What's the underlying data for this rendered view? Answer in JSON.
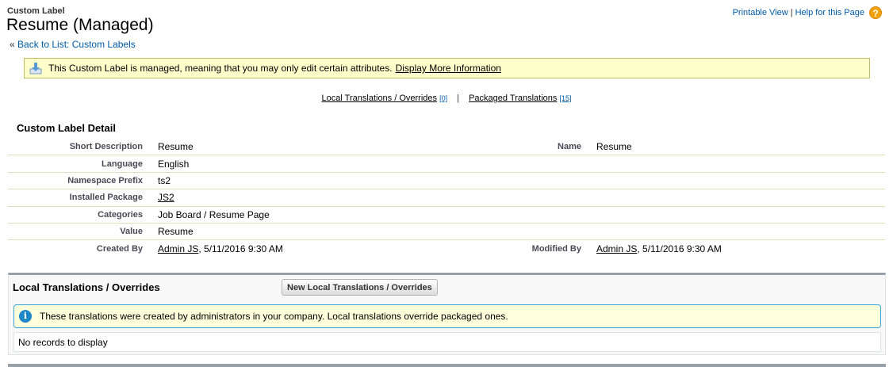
{
  "header": {
    "type_label": "Custom Label",
    "title": "Resume (Managed)",
    "back_prefix": "«",
    "back_link": "Back to List: Custom Labels",
    "printable_view": "Printable View",
    "separator": "|",
    "help_link": "Help for this Page",
    "help_icon": "question-mark-icon",
    "help_glyph": "?"
  },
  "notice": {
    "icon": "download-icon",
    "text": "This Custom Label is managed, meaning that you may only edit certain attributes.",
    "link": "Display More Information"
  },
  "related_links": {
    "local_label": "Local Translations / Overrides",
    "local_count": "[0]",
    "separator": "|",
    "packaged_label": "Packaged Translations",
    "packaged_count": "[15]"
  },
  "detail": {
    "title": "Custom Label Detail",
    "rows": [
      {
        "label": "Short Description",
        "value": "Resume",
        "label2": "Name",
        "value2": "Resume"
      },
      {
        "label": "Language",
        "value": "English",
        "label2": "",
        "value2": ""
      },
      {
        "label": "Namespace Prefix",
        "value": "ts2",
        "label2": "",
        "value2": ""
      },
      {
        "label": "Installed Package",
        "value": "JS2",
        "label2": "",
        "value2": ""
      },
      {
        "label": "Categories",
        "value": "Job Board / Resume Page",
        "label2": "",
        "value2": ""
      },
      {
        "label": "Value",
        "value": "Resume",
        "label2": "",
        "value2": ""
      },
      {
        "label": "Created By",
        "value_link": "Admin JS",
        "value_rest": ", 5/11/2016 9:30 AM",
        "label2": "Modified By",
        "value2_link": "Admin JS",
        "value2_rest": ", 5/11/2016 9:30 AM"
      }
    ]
  },
  "local_translations": {
    "title": "Local Translations / Overrides",
    "new_button": "New Local Translations / Overrides",
    "info_icon": "info-icon",
    "info_glyph": "i",
    "info_text": "These translations were created by administrators in your company. Local translations override packaged ones.",
    "empty_text": "No records to display"
  },
  "colors": {
    "link": "#015ba7",
    "notice_bg": "#ffffcc",
    "help_icon": "#f3a20b",
    "info_border": "#39a1da"
  }
}
